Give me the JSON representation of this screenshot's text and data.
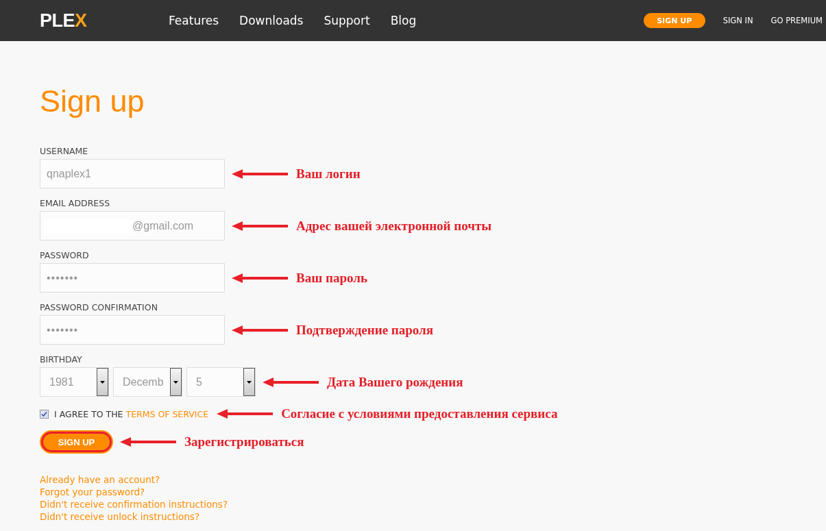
{
  "nav": {
    "logo": {
      "main": "PLE",
      "accent": "X"
    },
    "links": [
      "Features",
      "Downloads",
      "Support",
      "Blog"
    ],
    "signup": "SIGN UP",
    "signin": "SIGN IN",
    "premium": "GO PREMIUM"
  },
  "title": "Sign up",
  "fields": [
    {
      "kind": "text",
      "label": "USERNAME",
      "value": "qnaplex1",
      "annotation": "Ваш логин"
    },
    {
      "kind": "email",
      "label": "EMAIL ADDRESS",
      "value": "@gmail.com",
      "annotation": "Адрес вашей электронной почты"
    },
    {
      "kind": "password",
      "label": "PASSWORD",
      "value": "•••••••",
      "annotation": "Ваш пароль"
    },
    {
      "kind": "password",
      "label": "PASSWORD CONFIRMATION",
      "value": "•••••••",
      "annotation": "Подтверждение пароля"
    }
  ],
  "birthday": {
    "label": "BIRTHDAY",
    "selects": [
      "1981",
      "Decemb",
      "5"
    ],
    "annotation": "Дата Вашего рождения"
  },
  "agree": {
    "checked": true,
    "text": "I AGREE TO THE",
    "link": "TERMS OF SERVICE",
    "annotation": "Согласие с условиями предоставления сервиса"
  },
  "submit": {
    "label": "SIGN UP",
    "annotation": "Зарегистрироваться"
  },
  "links": [
    "Already have an account?",
    "Forgot your password?",
    "Didn't receive confirmation instructions?",
    "Didn't receive unlock instructions?"
  ]
}
